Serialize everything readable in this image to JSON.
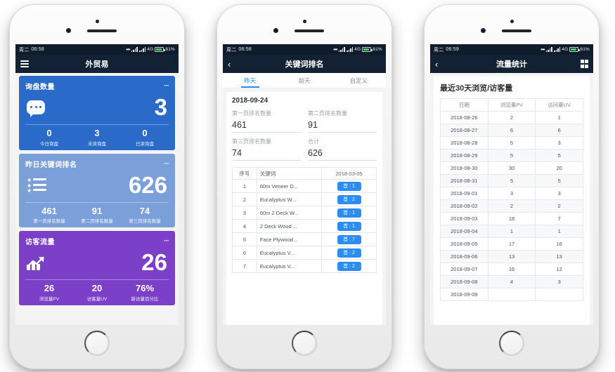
{
  "phones": [
    {
      "id": "dashboard",
      "statusbar": {
        "day": "周二",
        "time": "06:58",
        "dots": "•••",
        "network": "4G",
        "battery_text": "81%",
        "battery_level": 81
      },
      "navbar": {
        "menu_icon": "hamburger-icon",
        "title": "外贸易"
      },
      "cards": [
        {
          "title": "询盘数量",
          "more": "···",
          "icon": "chat-bubble-icon",
          "value": "3",
          "color": "#2a6ac8",
          "stats": [
            {
              "value": "0",
              "label": "今日询盘"
            },
            {
              "value": "3",
              "label": "未读询盘"
            },
            {
              "value": "0",
              "label": "已读询盘"
            }
          ]
        },
        {
          "title": "昨日关键词排名",
          "more": "···",
          "icon": "star-list-icon",
          "value": "626",
          "color": "#7b9fd8",
          "stats": [
            {
              "value": "461",
              "label": "第一页排名数量"
            },
            {
              "value": "91",
              "label": "第二页排名数量"
            },
            {
              "value": "74",
              "label": "第三页排名数量"
            }
          ]
        },
        {
          "title": "访客流量",
          "more": "···",
          "icon": "growth-chart-icon",
          "value": "26",
          "color": "#7b3fc8",
          "stats": [
            {
              "value": "26",
              "label": "浏览量PV"
            },
            {
              "value": "20",
              "label": "访客量UV"
            },
            {
              "value": "76%",
              "label": "新访量百分比"
            }
          ]
        }
      ]
    },
    {
      "id": "keyword-ranking",
      "statusbar": {
        "day": "周二",
        "time": "06:58",
        "dots": "•••",
        "network": "4G",
        "battery_text": "81%",
        "battery_level": 81
      },
      "navbar": {
        "back_icon": "chevron-left-icon",
        "title": "关键词排名"
      },
      "tabs": [
        {
          "label": "昨天",
          "active": true
        },
        {
          "label": "前天",
          "active": false
        },
        {
          "label": "自定义",
          "active": false
        }
      ],
      "date": "2018-09-24",
      "metrics": [
        {
          "label": "第一页排名数量",
          "value": "461"
        },
        {
          "label": "第二页排名数量",
          "value": "91"
        },
        {
          "label": "第三页排名数量",
          "value": "74"
        },
        {
          "label": "合计",
          "value": "626"
        }
      ],
      "table": {
        "headers": [
          "序号",
          "关键词",
          "2018-03-05"
        ],
        "rows": [
          [
            "1",
            "60m Veneer D...",
            "首 : 1"
          ],
          [
            "2",
            "Eucalyptus W...",
            "首 : 2"
          ],
          [
            "3",
            "60m 2 Deck W...",
            "首 : 1"
          ],
          [
            "4",
            "2 Deck Wood ...",
            "首 : 1"
          ],
          [
            "5",
            "Face Plywood...",
            "首 : 7"
          ],
          [
            "6",
            "Eucalyptus V...",
            "首 : 2"
          ],
          [
            "7",
            "Eucalyptus V...",
            "首 : 2"
          ]
        ]
      }
    },
    {
      "id": "traffic-stats",
      "statusbar": {
        "day": "周二",
        "time": "06:59",
        "dots": "•••",
        "network": "4G",
        "battery_text": "81%",
        "battery_level": 81
      },
      "navbar": {
        "back_icon": "chevron-left-icon",
        "title": "流量统计",
        "right_icon": "grid-squares-icon"
      },
      "title": "最近30天浏览/访客量",
      "table": {
        "headers": [
          "日期",
          "浏览量PV",
          "访问量UV"
        ],
        "rows": [
          [
            "2018-08-26",
            "2",
            "1"
          ],
          [
            "2018-08-27",
            "6",
            "6"
          ],
          [
            "2018-08-28",
            "5",
            "3"
          ],
          [
            "2018-08-29",
            "5",
            "5"
          ],
          [
            "2018-08-30",
            "30",
            "20"
          ],
          [
            "2018-08-31",
            "5",
            "5"
          ],
          [
            "2018-09-01",
            "3",
            "3"
          ],
          [
            "2018-09-02",
            "2",
            "2"
          ],
          [
            "2018-09-03",
            "18",
            "7"
          ],
          [
            "2018-09-04",
            "1",
            "1"
          ],
          [
            "2018-09-05",
            "17",
            "16"
          ],
          [
            "2018-09-06",
            "13",
            "13"
          ],
          [
            "2018-09-07",
            "16",
            "12"
          ],
          [
            "2018-09-08",
            "4",
            "3"
          ],
          [
            "2018-09-09",
            "",
            ""
          ]
        ]
      }
    }
  ],
  "colors": {
    "navbar": "#122234",
    "statusbar": "#101c2c",
    "accent": "#2d8cf0",
    "card_blue": "#2a6ac8",
    "card_lightblue": "#7b9fd8",
    "card_purple": "#7b3fc8",
    "battery_green": "#46d063"
  }
}
